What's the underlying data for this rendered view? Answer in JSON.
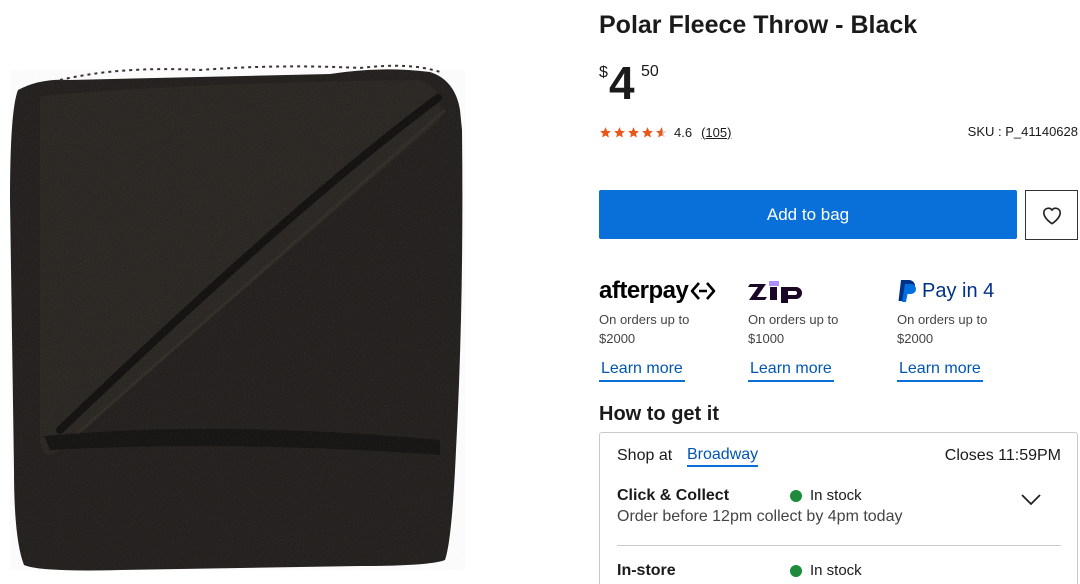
{
  "product": {
    "title": "Polar Fleece Throw - Black",
    "price": {
      "currency": "$",
      "whole": "4",
      "cents": "50"
    },
    "rating": {
      "score": "4.6",
      "count": "(105)",
      "stars": 4.6
    },
    "sku": "SKU : P_41140628",
    "image_icon": "folded-black-fleece-blanket"
  },
  "actions": {
    "add_to_bag": "Add to bag",
    "wishlist_icon": "heart-icon"
  },
  "payments": [
    {
      "brand": "afterpay",
      "desc": "On orders up to $2000",
      "learn": "Learn more"
    },
    {
      "brand": "zip",
      "logo_text": "zip",
      "desc": "On orders up to $1000",
      "learn": "Learn more"
    },
    {
      "brand": "paypal",
      "logo_text": "Pay in 4",
      "desc": "On orders up to $2000",
      "learn": "Learn more"
    }
  ],
  "fulfilment": {
    "heading": "How to get it",
    "shop_at_label": "Shop at",
    "store": "Broadway",
    "closes": "Closes 11:59PM",
    "click_collect": {
      "title": "Click & Collect",
      "status": "In stock",
      "subtitle": "Order before 12pm collect by 4pm today"
    },
    "in_store": {
      "title": "In-store",
      "status": "In stock"
    }
  },
  "colors": {
    "primary": "#0970da",
    "link": "#0056b3",
    "star": "#e8581a",
    "in_stock": "#1e8a3c",
    "zip_purple": "#aa8ffd",
    "paypal_blue": "#003087"
  }
}
